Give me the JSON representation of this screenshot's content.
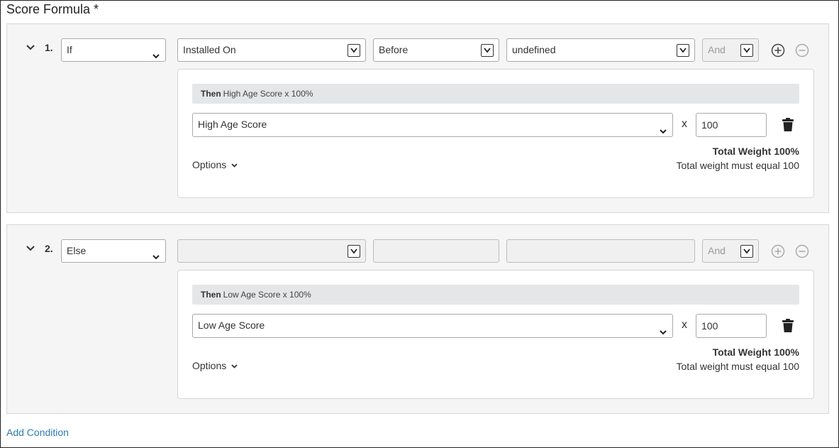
{
  "form": {
    "title": "Score Formula *",
    "add_condition_label": "Add Condition"
  },
  "conditions": [
    {
      "number": "1.",
      "type": "If",
      "field": "Installed On",
      "operator": "Before",
      "value": "undefined",
      "join": "And",
      "then_label": "Then",
      "then_text": "High Age Score x 100%",
      "score": "High Age Score",
      "multiplier_symbol": "x",
      "weight": "100",
      "total_weight": "Total Weight 100%",
      "total_note": "Total weight must equal 100",
      "options_label": "Options"
    },
    {
      "number": "2.",
      "type": "Else",
      "field": "",
      "operator": "",
      "value": "",
      "join": "And",
      "then_label": "Then",
      "then_text": "Low Age Score x 100%",
      "score": "Low Age Score",
      "multiplier_symbol": "x",
      "weight": "100",
      "total_weight": "Total Weight 100%",
      "total_note": "Total weight must equal 100",
      "options_label": "Options"
    }
  ],
  "icons": {
    "collapse": "chevron-down-icon",
    "add": "plus-circle-icon",
    "remove": "minus-circle-icon",
    "delete": "trash-icon",
    "dropdown": "chevron-down-icon"
  },
  "colors": {
    "link": "#2b7bbd",
    "panel_bg": "#f5f5f5",
    "then_bar": "#e4e6e8"
  }
}
